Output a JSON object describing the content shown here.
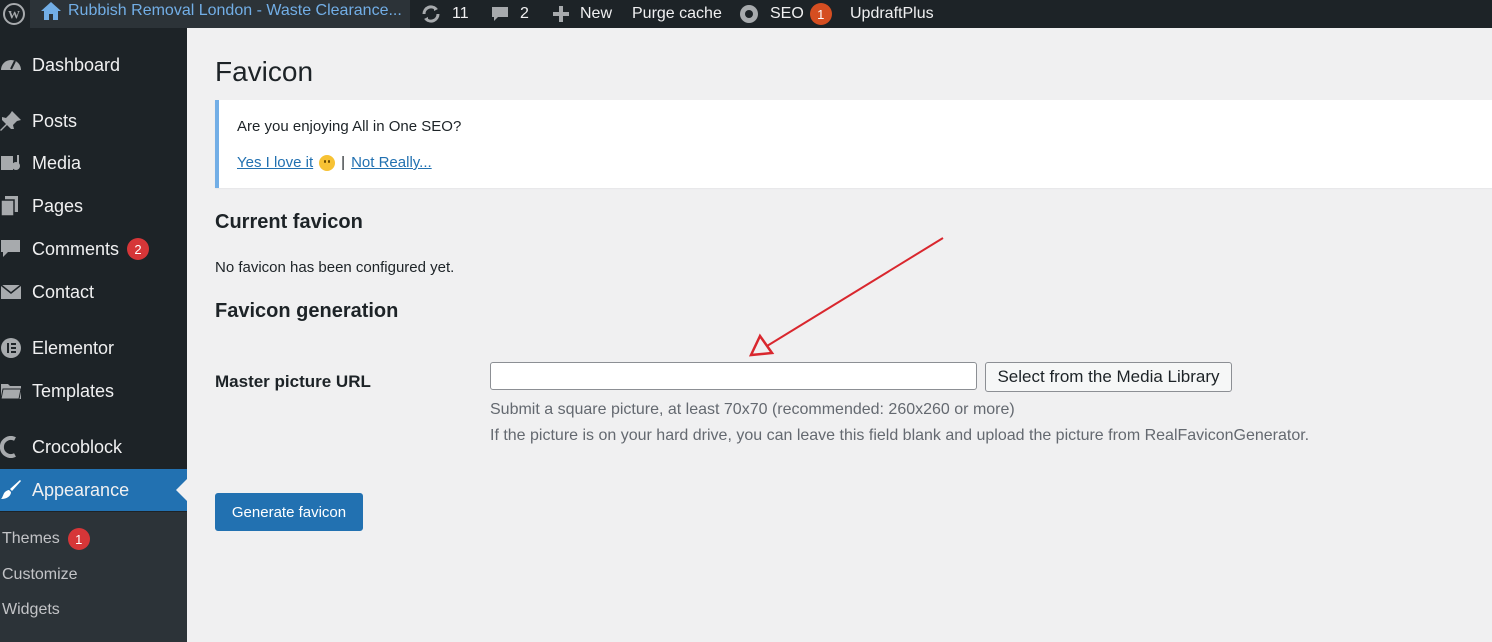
{
  "admin_bar": {
    "site_title": "Rubbish Removal London - Waste Clearance...",
    "updates_count": "11",
    "comments_count": "2",
    "new_label": "New",
    "purge_label": "Purge cache",
    "seo_label": "SEO",
    "seo_badge": "1",
    "updraft_label": "UpdraftPlus"
  },
  "sidebar": {
    "items": [
      {
        "label": "Dashboard",
        "icon": "dashboard-icon"
      },
      {
        "label": "Posts",
        "icon": "pin-icon"
      },
      {
        "label": "Media",
        "icon": "media-icon"
      },
      {
        "label": "Pages",
        "icon": "pages-icon"
      },
      {
        "label": "Comments",
        "icon": "comment-icon",
        "badge": "2"
      },
      {
        "label": "Contact",
        "icon": "mail-icon"
      },
      {
        "label": "Elementor",
        "icon": "elementor-icon"
      },
      {
        "label": "Templates",
        "icon": "folder-icon"
      },
      {
        "label": "Crocoblock",
        "icon": "crocoblock-icon"
      },
      {
        "label": "Appearance",
        "icon": "brush-icon"
      }
    ],
    "submenu": [
      {
        "label": "Themes",
        "badge": "1"
      },
      {
        "label": "Customize"
      },
      {
        "label": "Widgets"
      }
    ]
  },
  "page": {
    "title": "Favicon",
    "notice": {
      "question": "Are you enjoying All in One SEO?",
      "yes_link": "Yes I love it",
      "separator": "|",
      "no_link": "Not Really..."
    },
    "current": {
      "heading": "Current favicon",
      "text": "No favicon has been configured yet."
    },
    "generation": {
      "heading": "Favicon generation",
      "master_label": "Master picture URL",
      "input_value": "",
      "media_button": "Select from the Media Library",
      "help1": "Submit a square picture, at least 70x70 (recommended: 260x260 or more)",
      "help2": "If the picture is on your hard drive, you can leave this field blank and upload the picture from RealFaviconGenerator.",
      "generate_button": "Generate favicon"
    }
  },
  "colors": {
    "admin_bg": "#1d2327",
    "accent": "#2271b1",
    "badge": "#d63638",
    "annotation": "#d9272e"
  }
}
